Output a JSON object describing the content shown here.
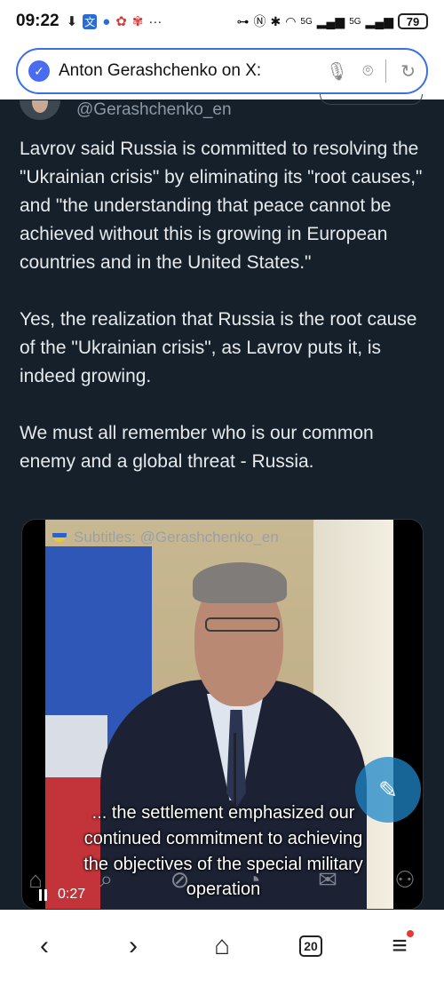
{
  "status": {
    "time": "09:22",
    "icons": [
      "download-icon",
      "translate-icon",
      "dot-icon",
      "app-icon",
      "app-icon",
      "more-icon"
    ],
    "network_1": "5G",
    "network_2": "5G",
    "battery": "79"
  },
  "address_bar": {
    "title": "Anton Gerashchenko on X:",
    "icons": [
      "verified-icon",
      "mic-icon",
      "camera-icon",
      "reload-icon"
    ]
  },
  "post": {
    "handle": "@Gerashchenko_en",
    "paragraphs": [
      "Lavrov said Russia is committed to resolving the \"Ukrainian crisis\" by eliminating its \"root causes,\" and \"the understanding that peace cannot be achieved without this is growing in European countries and in the United States.\"",
      "Yes, the realization that Russia is the root cause of the \"Ukrainian crisis\", as Lavrov puts it, is indeed growing.",
      "We must all remember who is our common enemy and a global threat - Russia."
    ]
  },
  "video": {
    "watermark": "Subtitles: @Gerashchenko_en",
    "subtitle_lines": [
      "... the settlement emphasized our",
      "continued commitment to achieving",
      "the objectives of the special military",
      "operation"
    ],
    "elapsed": "0:27"
  },
  "bottom_bar": {
    "tab_count": "20",
    "icons": [
      "back-icon",
      "forward-icon",
      "home-icon",
      "tabs-icon",
      "menu-icon"
    ]
  }
}
